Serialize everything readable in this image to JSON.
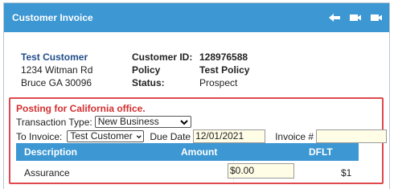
{
  "window": {
    "title": "Customer Invoice",
    "icons": [
      "back-arrow-icon",
      "video-camera-icon",
      "video-camera-icon"
    ]
  },
  "customer": {
    "name": "Test Customer",
    "address_line1": "1234 Witman Rd",
    "address_line2": "Bruce GA 30096"
  },
  "details": {
    "labels": [
      "Customer ID:",
      "Policy",
      "Status:"
    ],
    "values": [
      "128976588",
      "Test Policy",
      "Prospect"
    ]
  },
  "posting": {
    "title": "Posting for California office.",
    "transaction_type_label": "Transaction Type:",
    "transaction_type_value": "New Business",
    "to_invoice_label": "To Invoice:",
    "to_invoice_value": "Test Customer",
    "due_date_label": "Due Date",
    "due_date_value": "12/01/2021",
    "invoice_no_label": "Invoice #",
    "invoice_no_value": ""
  },
  "grid": {
    "columns": [
      "Description",
      "Amount",
      "DFLT"
    ],
    "rows": [
      {
        "description": "Assurance",
        "amount": "$0.00",
        "dflt": "$1"
      }
    ]
  },
  "colors": {
    "header_blue": "#3c97d3",
    "alert_red": "#d32f2f",
    "border_red": "#e0484c",
    "customer_name_blue": "#1f4d8a",
    "input_bg": "#fffde6"
  }
}
